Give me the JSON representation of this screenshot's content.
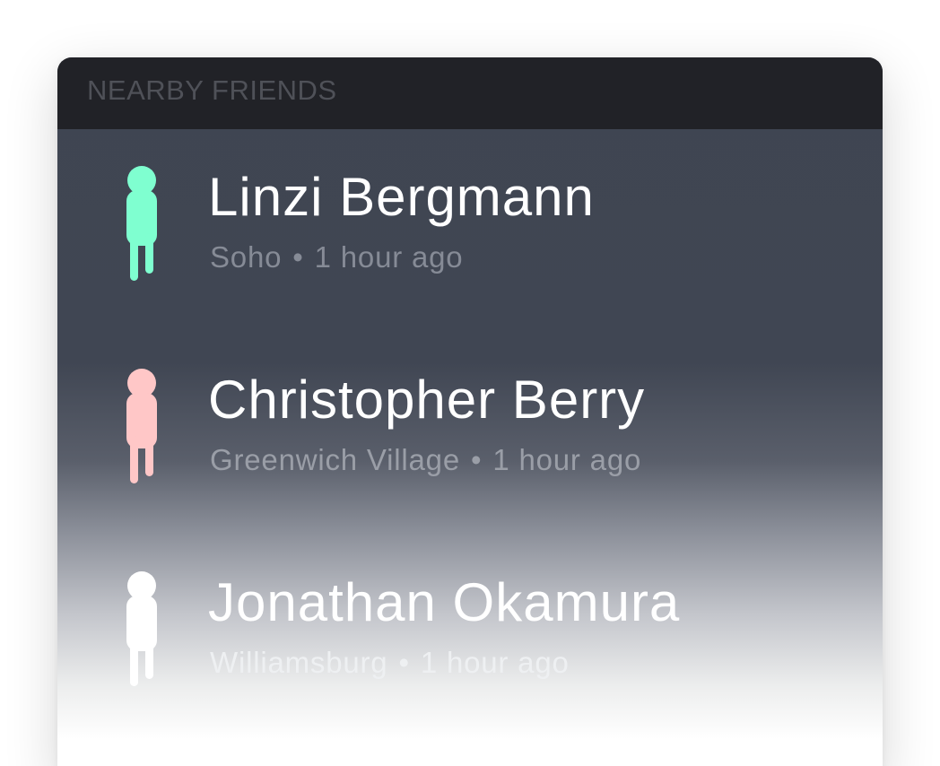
{
  "header": {
    "title": "NEARBY FRIENDS"
  },
  "friends": [
    {
      "name": "Linzi Bergmann",
      "location": "Soho",
      "separator": "•",
      "time": "1 hour ago",
      "avatar_icon": "person-icon",
      "avatar_color": "#7fffd0"
    },
    {
      "name": "Christopher Berry",
      "location": "Greenwich Village",
      "separator": "•",
      "time": "1 hour ago",
      "avatar_icon": "person-icon",
      "avatar_color": "#ffc7c7"
    },
    {
      "name": "Jonathan Okamura",
      "location": "Williamsburg",
      "separator": "•",
      "time": "1 hour ago",
      "avatar_icon": "person-icon",
      "avatar_color": "#ffffff"
    }
  ]
}
